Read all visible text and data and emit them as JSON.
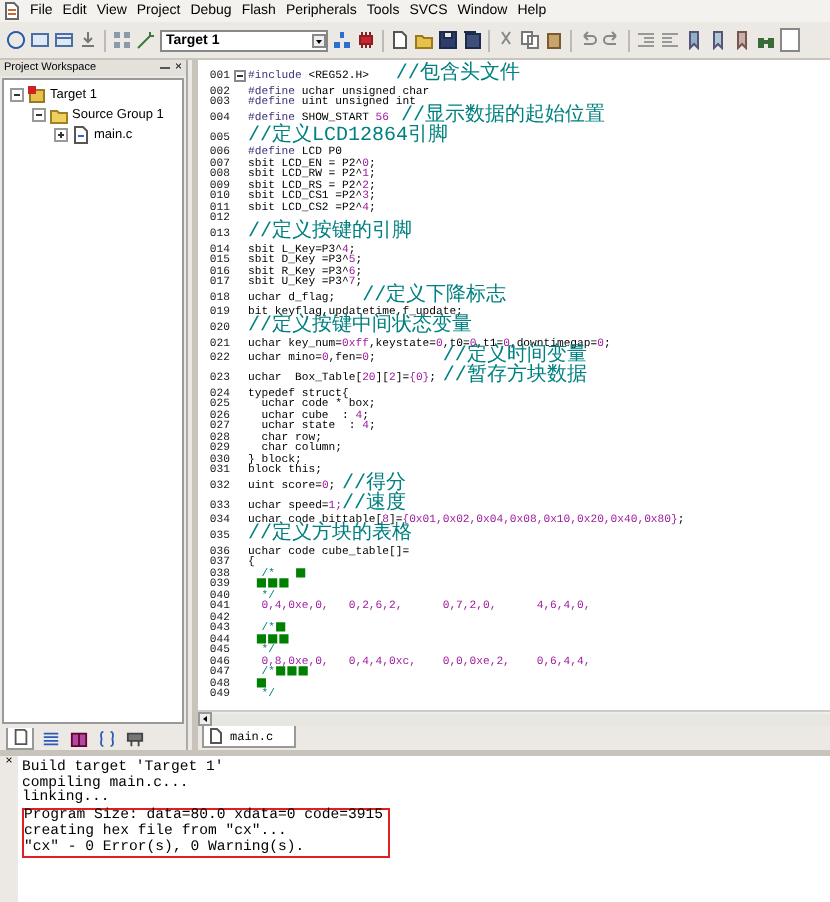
{
  "menu": [
    "File",
    "Edit",
    "View",
    "Project",
    "Debug",
    "Flash",
    "Peripherals",
    "Tools",
    "SVCS",
    "Window",
    "Help"
  ],
  "toolbar": {
    "target": "Target 1"
  },
  "workspace": {
    "title": "Project Workspace",
    "close": "×",
    "tree": [
      {
        "label": "Target 1",
        "kind": "target",
        "expanded": true,
        "children": [
          {
            "label": "Source Group 1",
            "kind": "group",
            "expanded": true,
            "children": [
              {
                "label": "main.c",
                "kind": "file",
                "expanded": false
              }
            ]
          }
        ]
      }
    ],
    "tabs": [
      {
        "selected": true
      },
      {
        "selected": false
      },
      {
        "selected": false
      },
      {
        "selected": false
      },
      {
        "selected": false
      }
    ]
  },
  "editor": {
    "tabs": [
      {
        "label": "main.c",
        "selected": true
      }
    ],
    "lines": [
      {
        "n": "001",
        "parts": [
          {
            "kind": "directive",
            "text": "#include"
          },
          {
            "kind": "code",
            "text": " <REG52.H>    "
          },
          {
            "kind": "remark",
            "text": "//包含头文件"
          }
        ]
      },
      {
        "n": "002",
        "parts": [
          {
            "kind": "directive",
            "text": "#define"
          },
          {
            "kind": "code",
            "text": " uchar unsigned char"
          }
        ]
      },
      {
        "n": "003",
        "parts": [
          {
            "kind": "directive",
            "text": "#define"
          },
          {
            "kind": "code",
            "text": " uint unsigned int"
          }
        ]
      },
      {
        "n": "004",
        "parts": [
          {
            "kind": "directive",
            "text": "#define"
          },
          {
            "kind": "code",
            "text": " SHOW_START "
          },
          {
            "kind": "number",
            "text": "56"
          },
          {
            "kind": "remark",
            "text": " //显示数据的起始位置"
          }
        ]
      },
      {
        "n": "005",
        "parts": [
          {
            "kind": "remark",
            "text": "//定义LCD12864引脚"
          }
        ]
      },
      {
        "n": "006",
        "parts": [
          {
            "kind": "directive",
            "text": "#define"
          },
          {
            "kind": "code",
            "text": " LCD P0"
          }
        ]
      },
      {
        "n": "007",
        "parts": [
          {
            "kind": "code",
            "text": "sbit LCD_EN = P2^"
          },
          {
            "kind": "number",
            "text": "0"
          },
          {
            "kind": "code",
            "text": ";"
          }
        ]
      },
      {
        "n": "008",
        "parts": [
          {
            "kind": "code",
            "text": "sbit LCD_RW = P2^"
          },
          {
            "kind": "number",
            "text": "1"
          },
          {
            "kind": "code",
            "text": ";"
          }
        ]
      },
      {
        "n": "009",
        "parts": [
          {
            "kind": "code",
            "text": "sbit LCD_RS = P2^"
          },
          {
            "kind": "number",
            "text": "2"
          },
          {
            "kind": "code",
            "text": ";"
          }
        ]
      },
      {
        "n": "010",
        "parts": [
          {
            "kind": "code",
            "text": "sbit LCD_CS1 =P2^"
          },
          {
            "kind": "number",
            "text": "3"
          },
          {
            "kind": "code",
            "text": ";"
          }
        ]
      },
      {
        "n": "011",
        "parts": [
          {
            "kind": "code",
            "text": "sbit LCD_CS2 =P2^"
          },
          {
            "kind": "number",
            "text": "4"
          },
          {
            "kind": "code",
            "text": ";"
          }
        ]
      },
      {
        "n": "012"
      },
      {
        "n": "013",
        "parts": [
          {
            "kind": "remark",
            "text": "//定义按键的引脚"
          }
        ]
      },
      {
        "n": "014",
        "parts": [
          {
            "kind": "code",
            "text": "sbit L_Key=P3^"
          },
          {
            "kind": "number",
            "text": "4"
          },
          {
            "kind": "code",
            "text": ";"
          }
        ]
      },
      {
        "n": "015",
        "parts": [
          {
            "kind": "code",
            "text": "sbit D_Key =P3^"
          },
          {
            "kind": "number",
            "text": "5"
          },
          {
            "kind": "code",
            "text": ";"
          }
        ]
      },
      {
        "n": "016",
        "parts": [
          {
            "kind": "code",
            "text": "sbit R_Key =P3^"
          },
          {
            "kind": "number",
            "text": "6"
          },
          {
            "kind": "code",
            "text": ";"
          }
        ]
      },
      {
        "n": "017",
        "parts": [
          {
            "kind": "code",
            "text": "sbit U_Key =P3^"
          },
          {
            "kind": "number",
            "text": "7"
          },
          {
            "kind": "code",
            "text": ";"
          }
        ]
      },
      {
        "n": "018",
        "parts": [
          {
            "kind": "code",
            "text": "uchar d_flag;    "
          },
          {
            "kind": "remark",
            "text": "//定义下降标志"
          }
        ]
      },
      {
        "n": "019",
        "parts": [
          {
            "kind": "code",
            "text": "bit keyflag,updatetime,f_update;"
          }
        ]
      },
      {
        "n": "020",
        "parts": [
          {
            "kind": "remark",
            "text": "//定义按键中间状态变量"
          }
        ]
      },
      {
        "n": "021",
        "parts": [
          {
            "kind": "code",
            "text": "uchar key_num="
          },
          {
            "kind": "number",
            "text": "0xff"
          },
          {
            "kind": "code",
            "text": ",keystate="
          },
          {
            "kind": "number",
            "text": "0"
          },
          {
            "kind": "code",
            "text": ",t0="
          },
          {
            "kind": "number",
            "text": "0"
          },
          {
            "kind": "code",
            "text": ",t1="
          },
          {
            "kind": "number",
            "text": "0"
          },
          {
            "kind": "code",
            "text": ",downtimegap="
          },
          {
            "kind": "number",
            "text": "0"
          },
          {
            "kind": "code",
            "text": ";"
          }
        ]
      },
      {
        "n": "022",
        "parts": [
          {
            "kind": "code",
            "text": "uchar mino="
          },
          {
            "kind": "number",
            "text": "0"
          },
          {
            "kind": "code",
            "text": ",fen="
          },
          {
            "kind": "number",
            "text": "0"
          },
          {
            "kind": "code",
            "text": ";          "
          },
          {
            "kind": "remark",
            "text": "//定义时间变量"
          }
        ]
      },
      {
        "n": "023",
        "parts": [
          {
            "kind": "code",
            "text": "uchar  Box_Table["
          },
          {
            "kind": "number",
            "text": "20"
          },
          {
            "kind": "code",
            "text": "]["
          },
          {
            "kind": "number",
            "text": "2"
          },
          {
            "kind": "code",
            "text": "]="
          },
          {
            "kind": "number",
            "text": "{0}"
          },
          {
            "kind": "code",
            "text": "; "
          },
          {
            "kind": "remark",
            "text": "//暂存方块数据"
          }
        ]
      },
      {
        "n": "024",
        "parts": [
          {
            "kind": "code",
            "text": "typedef struct{"
          }
        ]
      },
      {
        "n": "025",
        "parts": [
          {
            "kind": "code",
            "text": "  uchar code * box;"
          }
        ]
      },
      {
        "n": "026",
        "parts": [
          {
            "kind": "code",
            "text": "  uchar cube  : "
          },
          {
            "kind": "number",
            "text": "4"
          },
          {
            "kind": "code",
            "text": ";"
          }
        ]
      },
      {
        "n": "027",
        "parts": [
          {
            "kind": "code",
            "text": "  uchar state  : "
          },
          {
            "kind": "number",
            "text": "4"
          },
          {
            "kind": "code",
            "text": ";"
          }
        ]
      },
      {
        "n": "028",
        "parts": [
          {
            "kind": "code",
            "text": "  char row;"
          }
        ]
      },
      {
        "n": "029",
        "parts": [
          {
            "kind": "code",
            "text": "  char column;"
          }
        ]
      },
      {
        "n": "030",
        "parts": [
          {
            "kind": "code",
            "text": "} block;"
          }
        ]
      },
      {
        "n": "031",
        "parts": [
          {
            "kind": "code",
            "text": "block this;"
          }
        ]
      },
      {
        "n": "032",
        "parts": [
          {
            "kind": "code",
            "text": "uint score="
          },
          {
            "kind": "number",
            "text": "0"
          },
          {
            "kind": "code",
            "text": "; "
          },
          {
            "kind": "remark",
            "text": "//得分"
          }
        ]
      },
      {
        "n": "033",
        "parts": [
          {
            "kind": "code",
            "text": "uchar speed="
          },
          {
            "kind": "number",
            "text": "1;"
          },
          {
            "kind": "remark",
            "text": "//速度"
          }
        ]
      },
      {
        "n": "034",
        "parts": [
          {
            "kind": "code",
            "text": "uchar code bittable["
          },
          {
            "kind": "number",
            "text": "8"
          },
          {
            "kind": "code",
            "text": "]="
          },
          {
            "kind": "number",
            "text": "{0x01,0x02,0x04,0x08,0x10,0x20,0x40,0x80}"
          },
          {
            "kind": "code",
            "text": ";"
          }
        ]
      },
      {
        "n": "035",
        "parts": [
          {
            "kind": "remark",
            "text": "//定义方块的表格"
          }
        ]
      },
      {
        "n": "036",
        "parts": [
          {
            "kind": "code",
            "text": "uchar code cube_table[]="
          }
        ]
      },
      {
        "n": "037",
        "parts": [
          {
            "kind": "code",
            "text": "{"
          }
        ]
      },
      {
        "n": "038",
        "parts": [
          {
            "kind": "comment",
            "text": "  /*   "
          },
          {
            "kind": "block",
            "text": "■"
          }
        ]
      },
      {
        "n": "039",
        "parts": [
          {
            "kind": "block",
            "text": "  ■■■"
          }
        ]
      },
      {
        "n": "040",
        "parts": [
          {
            "kind": "comment",
            "text": "  */"
          }
        ]
      },
      {
        "n": "041",
        "parts": [
          {
            "kind": "number",
            "text": "  0,4,0xe,0,   0,2,6,2,      0,7,2,0,      4,6,4,0,"
          }
        ]
      },
      {
        "n": "042"
      },
      {
        "n": "043",
        "parts": [
          {
            "kind": "comment",
            "text": "  /*"
          },
          {
            "kind": "block",
            "text": "■"
          }
        ]
      },
      {
        "n": "044",
        "parts": [
          {
            "kind": "block",
            "text": "  ■■■"
          }
        ]
      },
      {
        "n": "045",
        "parts": [
          {
            "kind": "comment",
            "text": "  */"
          }
        ]
      },
      {
        "n": "046",
        "parts": [
          {
            "kind": "number",
            "text": "  0,8,0xe,0,   0,4,4,0xc,    0,0,0xe,2,    0,6,4,4,"
          }
        ]
      },
      {
        "n": "047",
        "parts": [
          {
            "kind": "comment",
            "text": "  /*"
          },
          {
            "kind": "block",
            "text": "■■■"
          }
        ]
      },
      {
        "n": "048",
        "parts": [
          {
            "kind": "block",
            "text": "  ■"
          }
        ]
      },
      {
        "n": "049",
        "parts": [
          {
            "kind": "comment",
            "text": "  */"
          }
        ]
      }
    ]
  },
  "output": {
    "close": "×",
    "lines": [
      {
        "text": "Build target 'Target 1'",
        "boxed": false
      },
      {
        "text": "compiling main.c...",
        "boxed": false
      },
      {
        "text": "linking...",
        "boxed": false
      },
      {
        "text": "Program Size: data=80.0 xdata=0 code=3915",
        "boxed": true
      },
      {
        "text": "creating hex file from \"cx\"...",
        "boxed": true
      },
      {
        "text": "\"cx\" - 0 Error(s), 0 Warning(s).",
        "boxed": true
      }
    ]
  }
}
